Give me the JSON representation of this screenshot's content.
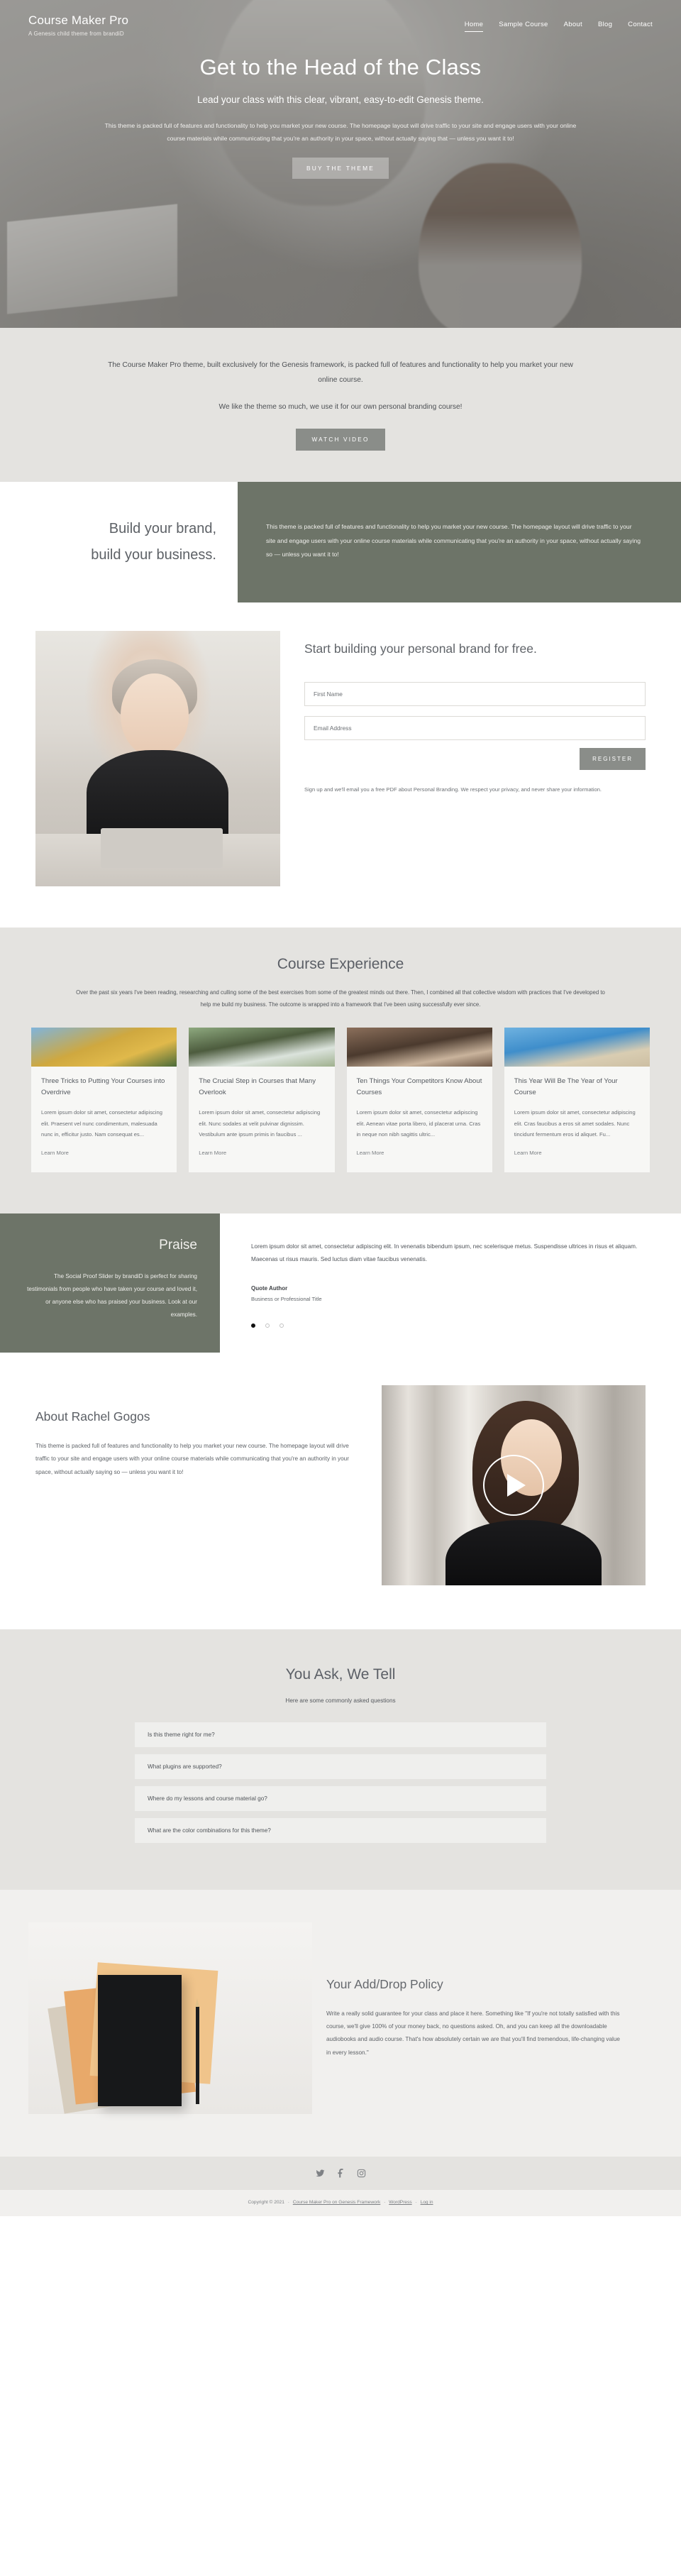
{
  "header": {
    "brand_title": "Course Maker Pro",
    "brand_tagline": "A Genesis child theme from brandiD",
    "nav": [
      {
        "label": "Home",
        "active": true
      },
      {
        "label": "Sample Course",
        "active": false
      },
      {
        "label": "About",
        "active": false
      },
      {
        "label": "Blog",
        "active": false
      },
      {
        "label": "Contact",
        "active": false
      }
    ]
  },
  "hero": {
    "title": "Get to the Head of the Class",
    "subtitle": "Lead your class with this clear, vibrant, easy-to-edit Genesis theme.",
    "body": "This theme is packed full of features and functionality to help you market your new course. The homepage layout will drive traffic to your site and engage users with your online course materials while communicating that you're an authority in your space, without actually saying that — unless you want it to!",
    "cta_label": "BUY THE THEME"
  },
  "intro": {
    "paragraph1": "The Course Maker Pro theme, built exclusively for the Genesis framework, is packed full of features and functionality to help you market your new online course.",
    "paragraph2": "We like the theme so much, we use it for our own personal branding course!",
    "cta_label": "WATCH VIDEO"
  },
  "brand_split": {
    "heading_line1": "Build your brand,",
    "heading_line2": "build your business.",
    "body": "This theme is packed full of features and functionality to help you market your new course. The homepage layout will drive traffic to your site and engage users with your online course materials while communicating that you're an authority in your space, without actually saying so — unless you want it to!"
  },
  "optin": {
    "heading": "Start building your personal brand for free.",
    "first_name_placeholder": "First Name",
    "email_placeholder": "Email Address",
    "first_name_value": "",
    "email_value": "",
    "register_label": "REGISTER",
    "note": "Sign up and we'll email you a free PDF about Personal Branding. We respect your privacy, and never share your information."
  },
  "courses": {
    "heading": "Course Experience",
    "intro": "Over the past six years I've been reading, researching and culling some of the best exercises from some of the greatest minds out there. Then, I combined all that collective wisdom with practices that I've developed to help me build my business. The outcome is wrapped into a framework that I've been using successfully ever since.",
    "cards": [
      {
        "title": "Three Tricks to Putting Your Courses into Overdrive",
        "text": "Lorem ipsum dolor sit amet, consectetur adipiscing elit. Praesent vel nunc condimentum, malesuada nunc in, efficitur justo. Nam consequat es...",
        "link": "Learn More"
      },
      {
        "title": "The Crucial Step in Courses that Many Overlook",
        "text": "Lorem ipsum dolor sit amet, consectetur adipiscing elit. Nunc sodales at velit pulvinar dignissim. Vestibulum ante ipsum primis in faucibus ...",
        "link": "Learn More"
      },
      {
        "title": "Ten Things Your Competitors Know About Courses",
        "text": "Lorem ipsum dolor sit amet, consectetur adipiscing elit. Aenean vitae porta libero, id placerat urna. Cras in neque non nibh sagittis ultric...",
        "link": "Learn More"
      },
      {
        "title": "This Year Will Be The Year of Your Course",
        "text": "Lorem ipsum dolor sit amet, consectetur adipiscing elit. Cras faucibus a eros sit amet sodales. Nunc tincidunt fermentum eros id aliquet. Fu...",
        "link": "Learn More"
      }
    ]
  },
  "praise": {
    "heading": "Praise",
    "description": "The Social Proof Slider by brandiD is perfect for sharing testimonials from people who have taken your course and loved it, or anyone else who has praised your business. Look at our examples.",
    "quote": "Lorem ipsum dolor sit amet, consectetur adipiscing elit. In venenatis bibendum ipsum, nec scelerisque metus. Suspendisse ultrices in risus et aliquam. Maecenas ut risus mauris. Sed luctus diam vitae faucibus venenatis.",
    "author": "Quote Author",
    "author_title": "Business or Professional Title",
    "slide_count": 3,
    "active_slide": 1
  },
  "about": {
    "heading": "About Rachel Gogos",
    "body": "This theme is packed full of features and functionality to help you market your new course. The homepage layout will drive traffic to your site and engage users with your online course materials while communicating that you're an authority in your space, without actually saying so — unless you want it to!"
  },
  "faq": {
    "heading": "You Ask, We Tell",
    "subheading": "Here are some commonly asked questions",
    "items": [
      "Is this theme right for me?",
      "What plugins are supported?",
      "Where do my lessons and course material go?",
      "What are the color combinations for this theme?"
    ]
  },
  "policy": {
    "heading": "Your Add/Drop Policy",
    "body": "Write a really solid guarantee for your class and place it here. Something like \"If you're not totally satisfied with this course, we'll give 100% of your money back, no questions asked. Oh, and you can keep all the downloadable audiobooks and audio course. That's how absolutely certain we are that you'll find tremendous, life-changing value in every lesson.\""
  },
  "footer": {
    "social": [
      "twitter-icon",
      "facebook-icon",
      "instagram-icon"
    ],
    "copyright_prefix": "Copyright © 2021",
    "link_theme": "Course Maker Pro on Genesis Framework",
    "link_wordpress": "WordPress",
    "link_login": "Log in"
  },
  "colors": {
    "accent_green": "#6d7468",
    "grey_button": "#8a8d89",
    "section_grey": "#e4e3e0",
    "text": "#4a4f54"
  }
}
